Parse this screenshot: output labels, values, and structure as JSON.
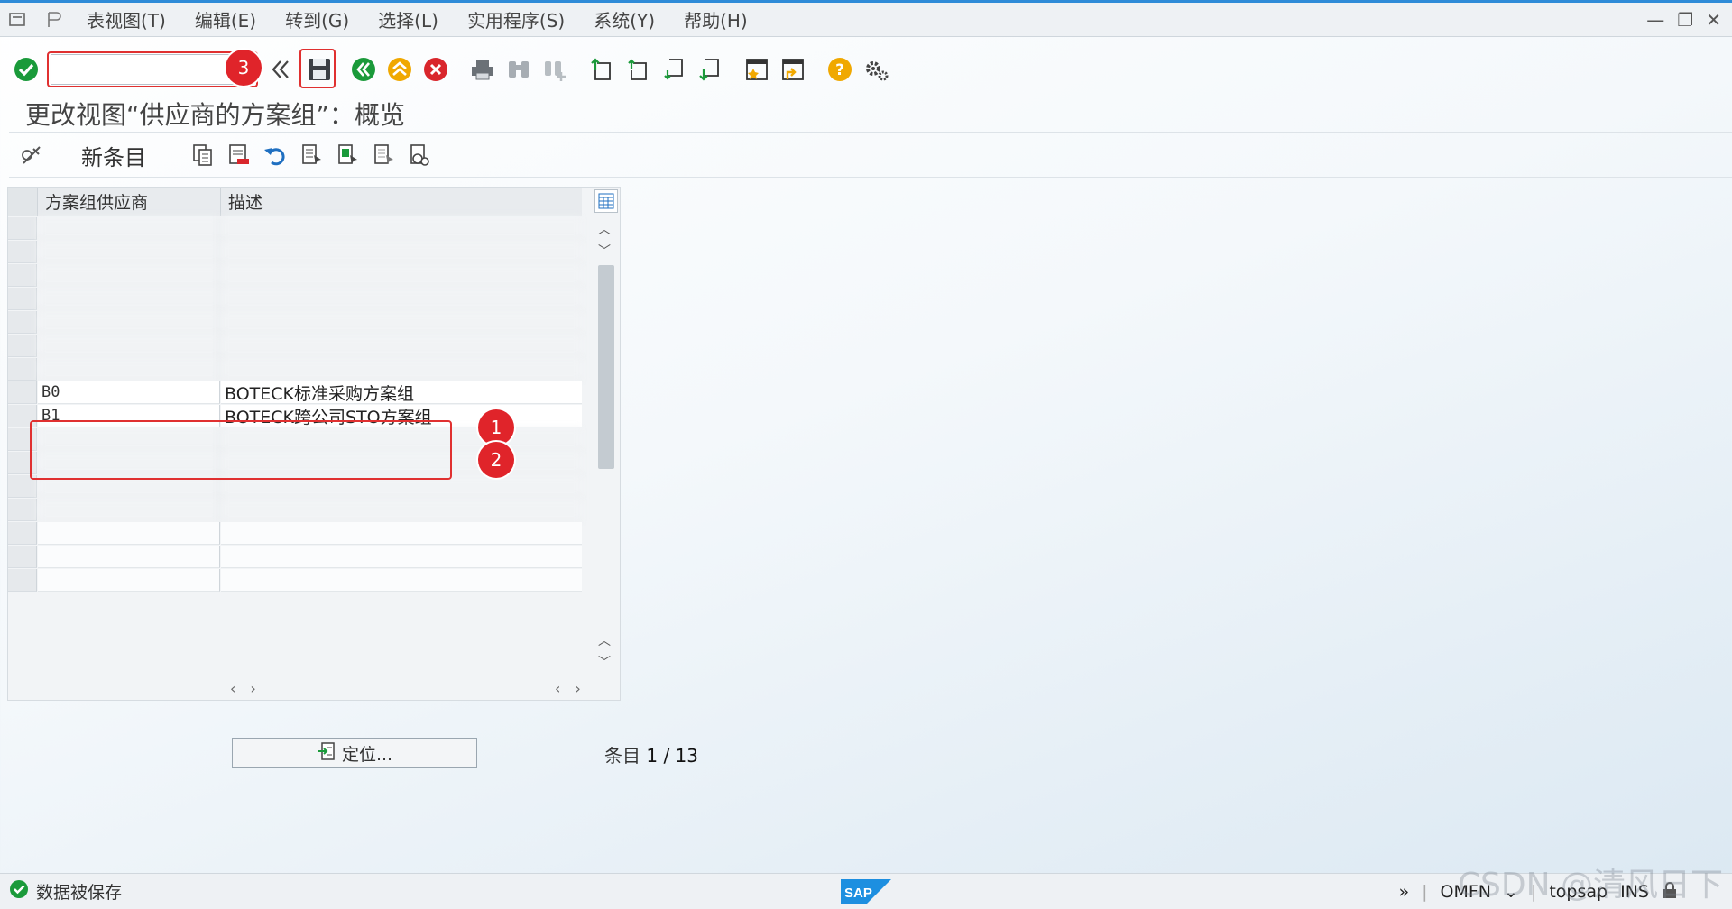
{
  "menu": {
    "items": [
      "表视图(T)",
      "编辑(E)",
      "转到(G)",
      "选择(L)",
      "实用程序(S)",
      "系统(Y)",
      "帮助(H)"
    ]
  },
  "toolbar": {
    "command_value": "",
    "icons": [
      "enter-check-icon",
      "save-icon",
      "back-icon",
      "exit-icon",
      "cancel-icon",
      "print-icon",
      "find-icon",
      "find-next-icon",
      "first-page-icon",
      "prev-page-icon",
      "next-page-icon",
      "last-page-icon",
      "bookmark-icon",
      "shortcut-icon",
      "help-icon",
      "settings-icon"
    ]
  },
  "annotations": {
    "badge1": "1",
    "badge2": "2",
    "badge3": "3"
  },
  "page_title": "更改视图“供应商的方案组”：概览",
  "app_toolbar": {
    "new_entry": "新条目"
  },
  "table": {
    "columns": [
      "方案组供应商",
      "描述"
    ],
    "rows": [
      {
        "code": "",
        "desc": "",
        "blurred": true
      },
      {
        "code": "",
        "desc": "",
        "blurred": true
      },
      {
        "code": "",
        "desc": "",
        "blurred": true
      },
      {
        "code": "",
        "desc": "",
        "blurred": true
      },
      {
        "code": "",
        "desc": "",
        "blurred": true
      },
      {
        "code": "",
        "desc": "",
        "blurred": true
      },
      {
        "code": "",
        "desc": "",
        "blurred": true
      },
      {
        "code": "B0",
        "desc": "BOTECK标准采购方案组",
        "blurred": false
      },
      {
        "code": "B1",
        "desc": "BOTECK跨公司STO方案组",
        "blurred": false
      },
      {
        "code": "",
        "desc": "",
        "blurred": true
      },
      {
        "code": "",
        "desc": "",
        "blurred": true
      },
      {
        "code": "",
        "desc": "",
        "blurred": true
      },
      {
        "code": "",
        "desc": "",
        "blurred": true
      },
      {
        "code": "",
        "desc": "",
        "blurred": false
      },
      {
        "code": "",
        "desc": "",
        "blurred": false
      },
      {
        "code": "",
        "desc": "",
        "blurred": false
      }
    ]
  },
  "locate_button": "定位...",
  "entry_label": "条目",
  "entry_count": "1 / 13",
  "status": {
    "message": "数据被保存",
    "transaction": "OMFN",
    "system": "topsap",
    "mode": "INS"
  },
  "colors": {
    "accent": "#2e8bd8",
    "badge": "#e0242a",
    "ok_green": "#1a9a3a"
  }
}
